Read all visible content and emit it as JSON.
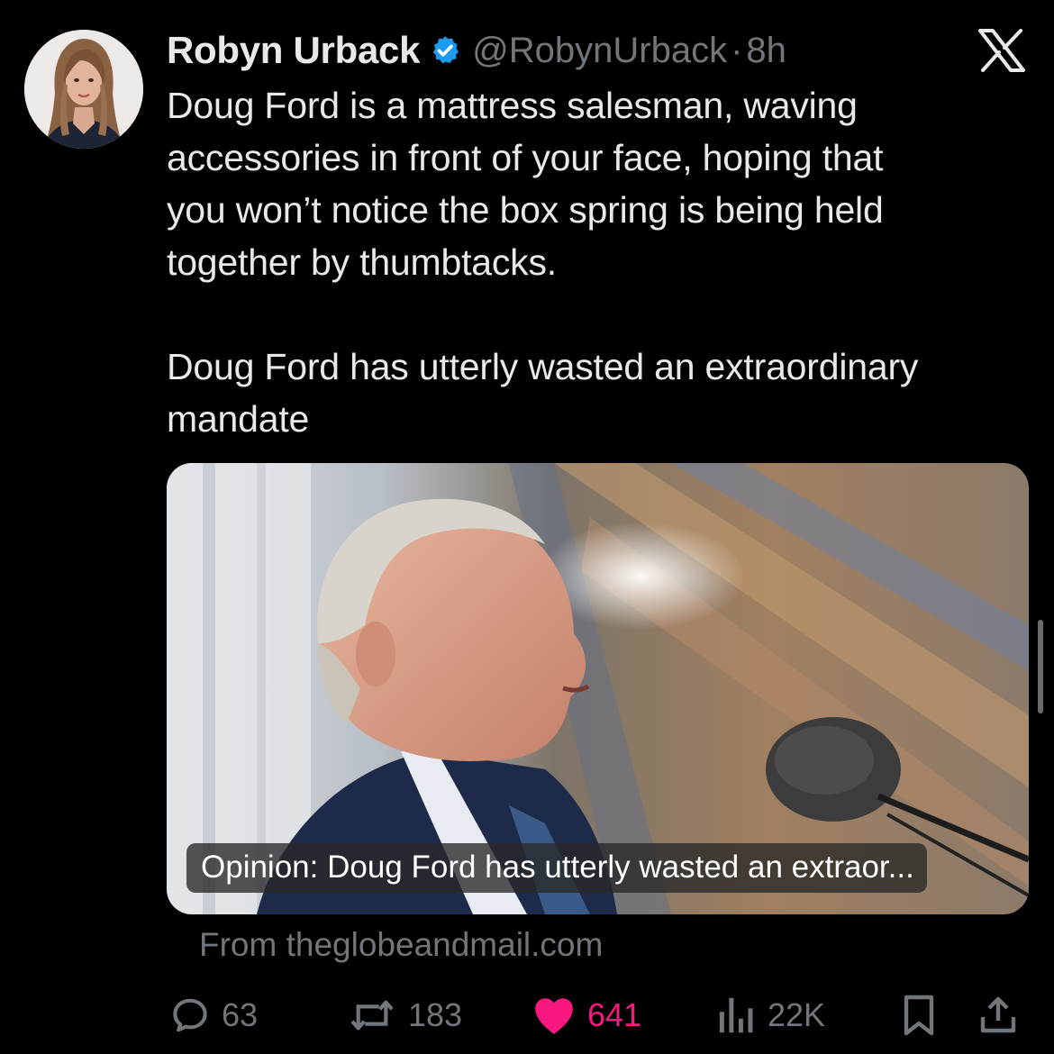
{
  "tweet": {
    "author_name": "Robyn Urback",
    "handle": "@RobynUrback",
    "separator": "·",
    "time": "8h",
    "text": "Doug Ford is a mattress salesman, waving\naccessories in front of your face, hoping that\nyou won’t notice the box spring is being held\ntogether by thumbtacks.\n\nDoug Ford has utterly wasted an extraordinary\nmandate",
    "verified_icon": "verified-badge-icon",
    "brand_icon": "x-logo-icon"
  },
  "link_card": {
    "title": "Opinion: Doug Ford has utterly wasted an extraor...",
    "source": "From theglobeandmail.com"
  },
  "actions": {
    "replies": "63",
    "reposts": "183",
    "likes": "641",
    "views": "22K",
    "icons": [
      "reply-icon",
      "repost-icon",
      "like-icon",
      "views-icon",
      "bookmark-icon",
      "share-icon"
    ]
  },
  "colors": {
    "background": "#000000",
    "text": "#e7e9ea",
    "secondary": "#71767b",
    "verified": "#1d9bf0",
    "like": "#f91880"
  }
}
